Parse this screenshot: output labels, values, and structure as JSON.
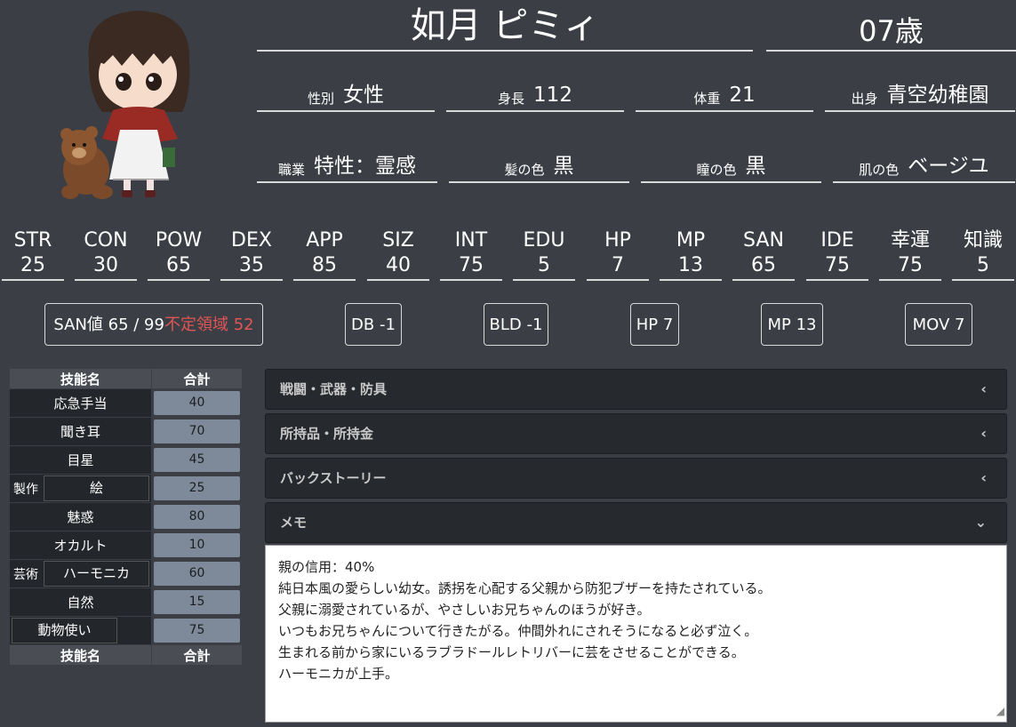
{
  "character": {
    "name": "如月 ピミィ",
    "age": "07歳"
  },
  "profile": [
    {
      "label": "性別",
      "value": "女性"
    },
    {
      "label": "身長",
      "value": "112"
    },
    {
      "label": "体重",
      "value": "21"
    },
    {
      "label": "出身",
      "value": "青空幼稚園"
    },
    {
      "label": "職業",
      "value": "特性：霊感"
    },
    {
      "label": "髪の色",
      "value": "黒"
    },
    {
      "label": "瞳の色",
      "value": "黒"
    },
    {
      "label": "肌の色",
      "value": "ベージユ"
    }
  ],
  "stats": [
    {
      "label": "STR",
      "value": "25"
    },
    {
      "label": "CON",
      "value": "30"
    },
    {
      "label": "POW",
      "value": "65"
    },
    {
      "label": "DEX",
      "value": "35"
    },
    {
      "label": "APP",
      "value": "85"
    },
    {
      "label": "SIZ",
      "value": "40"
    },
    {
      "label": "INT",
      "value": "75"
    },
    {
      "label": "EDU",
      "value": "5"
    },
    {
      "label": "HP",
      "value": "7"
    },
    {
      "label": "MP",
      "value": "13"
    },
    {
      "label": "SAN",
      "value": "65"
    },
    {
      "label": "IDE",
      "value": "75"
    },
    {
      "label": "幸運",
      "value": "75"
    },
    {
      "label": "知識",
      "value": "5"
    }
  ],
  "derived": {
    "san": "SAN値 65 / 99",
    "indefinite": "不定領域 52",
    "db": "DB -1",
    "bld": "BLD -1",
    "hp": "HP 7",
    "mp": "MP 13",
    "mov": "MOV 7"
  },
  "skills": {
    "header_name": "技能名",
    "header_total": "合計",
    "rows": [
      {
        "name": "応急手当",
        "value": "40"
      },
      {
        "name": "聞き耳",
        "value": "70"
      },
      {
        "name": "目星",
        "value": "45"
      },
      {
        "group": "製作",
        "name": "絵",
        "value": "25"
      },
      {
        "name": "魅惑",
        "value": "80"
      },
      {
        "name": "オカルト",
        "value": "10"
      },
      {
        "group": "芸術",
        "name": "ハーモニカ",
        "value": "60"
      },
      {
        "name": "自然",
        "value": "15"
      },
      {
        "name": "動物使い",
        "value": "75"
      }
    ]
  },
  "sections": [
    {
      "label": "戦闘・武器・防具",
      "icon": "chevron-left-icon"
    },
    {
      "label": "所持品・所持金",
      "icon": "chevron-left-icon"
    },
    {
      "label": "バックストーリー",
      "icon": "chevron-left-icon"
    },
    {
      "label": "メモ",
      "icon": "chevron-down-icon"
    }
  ],
  "memo": [
    "親の信用：40%",
    "純日本風の愛らしい幼女。誘拐を心配する父親から防犯ブザーを持たされている。",
    "父親に溺愛されているが、やさしいお兄ちゃんのほうが好き。",
    "いつもお兄ちゃんについて行きたがる。仲間外れにされそうになると必ず泣く。",
    "生まれる前から家にいるラブラドールレトリバーに芸をさせることができる。",
    "ハーモニカが上手。"
  ],
  "colors": {
    "background": "#3b3f45",
    "accent_red": "#e05555",
    "skill_value_bg": "#7e8a9a"
  }
}
